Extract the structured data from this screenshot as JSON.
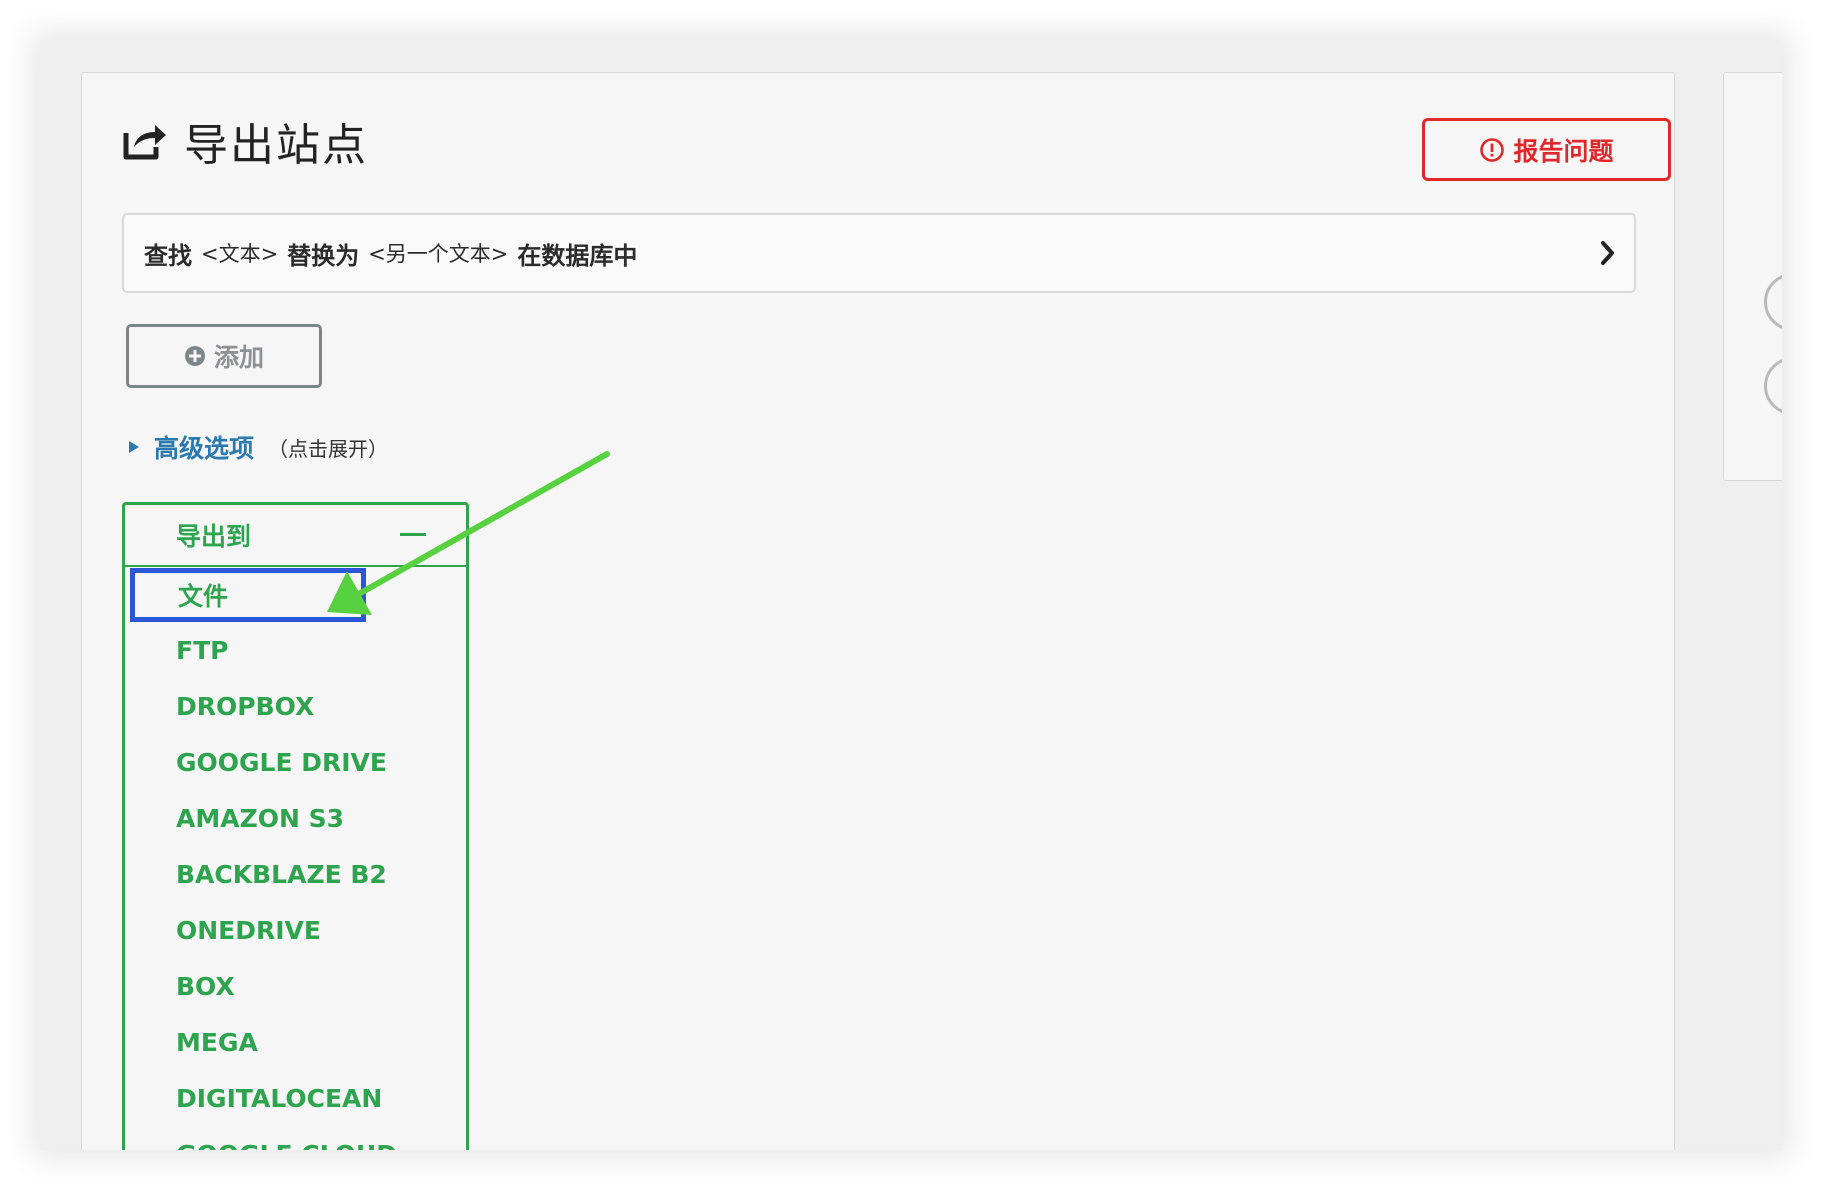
{
  "page": {
    "title": "导出站点",
    "title_icon": "share-export-icon"
  },
  "report_button": {
    "label": "报告问题",
    "icon": "alert-circle-icon",
    "color": "#e0282a"
  },
  "find_replace": {
    "find_text": "查找",
    "placeholder_1": "<文本>",
    "replace_text": "替换为",
    "placeholder_2": "<另一个文本>",
    "suffix": "在数据库中",
    "chevron_icon": "chevron-right-icon"
  },
  "add_button": {
    "label": "添加",
    "icon": "plus-circle-icon"
  },
  "advanced": {
    "label": "高级选项",
    "hint": "（点击展开）",
    "icon": "triangle-right-icon",
    "color": "#2a7ab0"
  },
  "export_to": {
    "header": "导出到",
    "collapse_icon": "minus-icon",
    "accent_color": "#2ea44f",
    "selected_highlight_color": "#2b57d6",
    "items": [
      "文件",
      "FTP",
      "DROPBOX",
      "GOOGLE DRIVE",
      "AMAZON S3",
      "BACKBLAZE B2",
      "ONEDRIVE",
      "BOX",
      "MEGA",
      "DIGITALOCEAN",
      "GOOGLE CLOUD"
    ],
    "selected_index": 0
  },
  "annotation": {
    "arrow_color": "#58d141"
  }
}
